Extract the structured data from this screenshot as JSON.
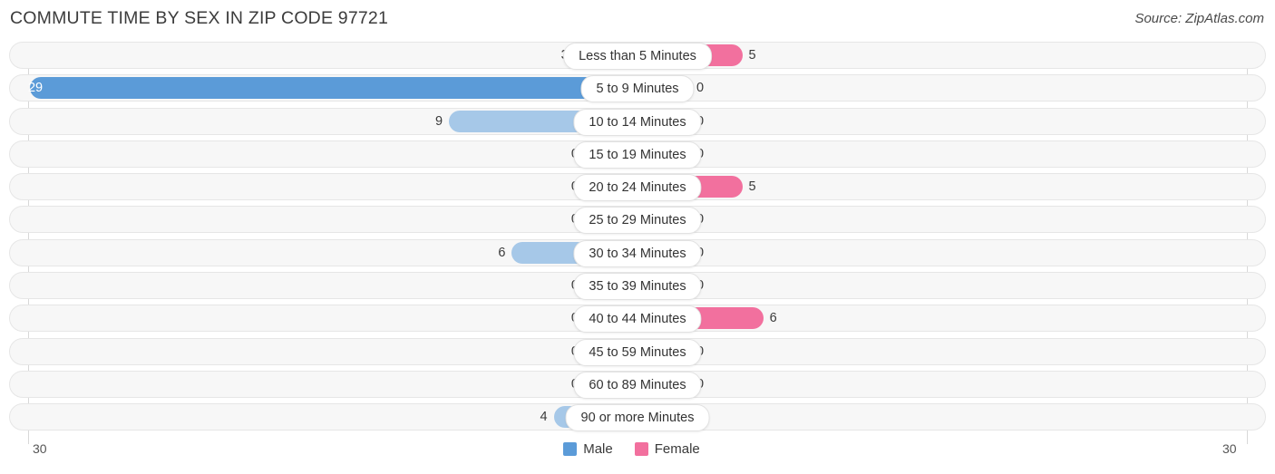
{
  "header": {
    "title": "COMMUTE TIME BY SEX IN ZIP CODE 97721",
    "source": "Source: ZipAtlas.com"
  },
  "axis": {
    "left_label": "30",
    "right_label": "30",
    "max": 30
  },
  "legend": {
    "items": [
      {
        "label": "Male",
        "color": "#5b9bd8"
      },
      {
        "label": "Female",
        "color": "#f2709e"
      }
    ]
  },
  "colors": {
    "male_light": "#a6c8e8",
    "male_strong": "#5b9bd8",
    "female_light": "#f8b4cc",
    "female_strong": "#f2709e",
    "track": "#f7f7f7",
    "gridline": "#d8d8d8"
  },
  "chart_data": {
    "type": "bar",
    "title": "COMMUTE TIME BY SEX IN ZIP CODE 97721",
    "subtitle": "",
    "xlabel": "",
    "ylabel": "",
    "orientation": "horizontal-diverging",
    "xlim": [
      30,
      30
    ],
    "grid": true,
    "legend_position": "bottom-center",
    "categories": [
      "Less than 5 Minutes",
      "5 to 9 Minutes",
      "10 to 14 Minutes",
      "15 to 19 Minutes",
      "20 to 24 Minutes",
      "25 to 29 Minutes",
      "30 to 34 Minutes",
      "35 to 39 Minutes",
      "40 to 44 Minutes",
      "45 to 59 Minutes",
      "60 to 89 Minutes",
      "90 or more Minutes"
    ],
    "series": [
      {
        "name": "Male",
        "values": [
          3,
          29,
          9,
          0,
          0,
          0,
          6,
          0,
          0,
          0,
          0,
          4
        ]
      },
      {
        "name": "Female",
        "values": [
          5,
          0,
          0,
          0,
          5,
          0,
          0,
          0,
          6,
          0,
          0,
          0
        ]
      }
    ]
  },
  "rows": [
    {
      "category": "Less than 5 Minutes",
      "male": "3",
      "female": "5"
    },
    {
      "category": "5 to 9 Minutes",
      "male": "29",
      "female": "0"
    },
    {
      "category": "10 to 14 Minutes",
      "male": "9",
      "female": "0"
    },
    {
      "category": "15 to 19 Minutes",
      "male": "0",
      "female": "0"
    },
    {
      "category": "20 to 24 Minutes",
      "male": "0",
      "female": "5"
    },
    {
      "category": "25 to 29 Minutes",
      "male": "0",
      "female": "0"
    },
    {
      "category": "30 to 34 Minutes",
      "male": "6",
      "female": "0"
    },
    {
      "category": "35 to 39 Minutes",
      "male": "0",
      "female": "0"
    },
    {
      "category": "40 to 44 Minutes",
      "male": "0",
      "female": "6"
    },
    {
      "category": "45 to 59 Minutes",
      "male": "0",
      "female": "0"
    },
    {
      "category": "60 to 89 Minutes",
      "male": "0",
      "female": "0"
    },
    {
      "category": "90 or more Minutes",
      "male": "4",
      "female": "0"
    }
  ]
}
